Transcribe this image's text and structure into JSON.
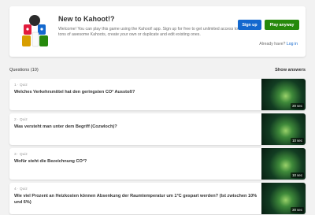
{
  "promo": {
    "title": "New to Kahoot!?",
    "text": "Welcome! You can play this game using the Kahoot! app. Sign up for free to get unlimited access to tons of awesome Kahoots, create your own or duplicate and edit existing ones.",
    "signup_label": "Sign up",
    "play_label": "Play anyway",
    "login_prefix": "Already have? ",
    "login_link": "Log in"
  },
  "questions": {
    "header": "Questions (10)",
    "show_answers": "Show answers",
    "items": [
      {
        "label": "1 · Quiz",
        "text": "Welches Verkehrsmittel hat den geringsten CO² Ausstoß?",
        "time": "20 sec"
      },
      {
        "label": "2 · Quiz",
        "text": "Was versteht man unter dem Begriff (Cozwloch)?",
        "time": "10 sec"
      },
      {
        "label": "3 · Quiz",
        "text": "Wofür steht die Bezeichnung CO²?",
        "time": "10 sec"
      },
      {
        "label": "4 · Quiz",
        "text": "Wie viel Prozent an Heizkosten können Absenkung der Raumtemperatur um 1°C gespart werden? (Ist zwischen 10% und 6%)",
        "time": "20 sec"
      }
    ]
  },
  "colors": {
    "signup": "#1368ce",
    "play": "#26890c",
    "background": "#f2f2f2"
  },
  "icons": [
    "kahoot-mascots-illustration",
    "question-thumbnail-image"
  ]
}
